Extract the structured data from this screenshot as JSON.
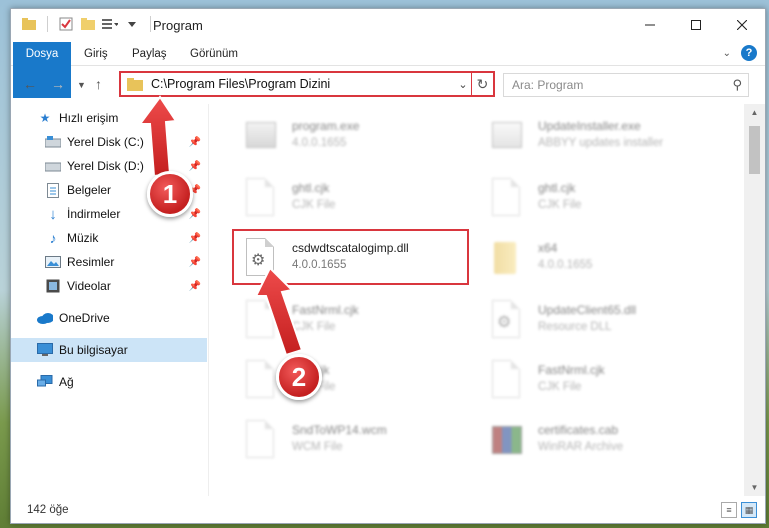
{
  "window": {
    "title": "Program"
  },
  "ribbon": {
    "tabs": [
      "Dosya",
      "Giriş",
      "Paylaş",
      "Görünüm"
    ]
  },
  "address": {
    "path": "C:\\Program Files\\Program Dizini"
  },
  "search": {
    "placeholder": "Ara: Program"
  },
  "sidebar": {
    "items": [
      {
        "label": "Hızlı erişim",
        "icon": "star-icon",
        "pinned": false
      },
      {
        "label": "Yerel Disk (C:)",
        "icon": "drive-icon",
        "pinned": true
      },
      {
        "label": "Yerel Disk (D:)",
        "icon": "drive-icon",
        "pinned": true
      },
      {
        "label": "Belgeler",
        "icon": "documents-icon",
        "pinned": true
      },
      {
        "label": "İndirmeler",
        "icon": "download-icon",
        "pinned": true
      },
      {
        "label": "Müzik",
        "icon": "music-icon",
        "pinned": true
      },
      {
        "label": "Resimler",
        "icon": "pictures-icon",
        "pinned": true
      },
      {
        "label": "Videolar",
        "icon": "videos-icon",
        "pinned": true
      },
      {
        "label": "OneDrive",
        "icon": "cloud-icon",
        "pinned": false
      },
      {
        "label": "Bu bilgisayar",
        "icon": "computer-icon",
        "pinned": false,
        "selected": true
      },
      {
        "label": "Ağ",
        "icon": "network-icon",
        "pinned": false
      }
    ]
  },
  "files": [
    {
      "name": "program.exe",
      "sub": "4.0.0.1655",
      "icon": "exe-icon",
      "faded": true
    },
    {
      "name": "UpdateInstaller.exe",
      "sub": "ABBYY updates installer",
      "icon": "exe-icon",
      "faded": true
    },
    {
      "name": "ghtl.cjk",
      "sub": "CJK File",
      "icon": "document-icon",
      "faded": true
    },
    {
      "name": "ghtl.cjk",
      "sub": "CJK File",
      "icon": "document-icon",
      "faded": true
    },
    {
      "name": "csdwdtscatalogimp.dll",
      "sub": "4.0.0.1655",
      "icon": "dll-gear-icon",
      "faded": false,
      "highlighted": true
    },
    {
      "name": "x64",
      "sub": "4.0.0.1655",
      "icon": "folder-icon",
      "faded": true
    },
    {
      "name": "FastNrml.cjk",
      "sub": "CJK File",
      "icon": "document-icon",
      "faded": true
    },
    {
      "name": "UpdateClient65.dll",
      "sub": "Resource DLL",
      "icon": "dll-gear-icon",
      "faded": true
    },
    {
      "name": "ghtl.cjk",
      "sub": "CJK File",
      "icon": "document-icon",
      "faded": true
    },
    {
      "name": "FastNrml.cjk",
      "sub": "CJK File",
      "icon": "document-icon",
      "faded": true
    },
    {
      "name": "SndToWP14.wcm",
      "sub": "WCM File",
      "icon": "document-icon",
      "faded": true
    },
    {
      "name": "certificates.cab",
      "sub": "WinRAR Archive",
      "icon": "winrar-icon",
      "faded": true
    }
  ],
  "status": {
    "count": "142 öğe"
  },
  "callouts": [
    "1",
    "2"
  ],
  "colors": {
    "accent": "#1979ca",
    "highlight": "#d9363e",
    "selected": "#cce4f7"
  }
}
